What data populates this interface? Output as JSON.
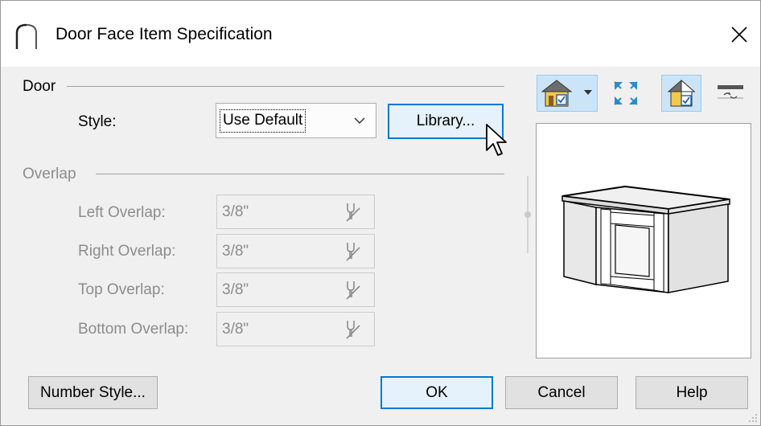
{
  "window": {
    "title": "Door Face Item Specification",
    "close_symbol": "✕"
  },
  "door_group": {
    "label": "Door",
    "style_label": "Style:",
    "style_value": "Use Default",
    "library_button": "Library..."
  },
  "overlap_group": {
    "label": "Overlap",
    "fields": [
      {
        "label": "Left Overlap:",
        "value": "3/8\""
      },
      {
        "label": "Right Overlap:",
        "value": "3/8\""
      },
      {
        "label": "Top Overlap:",
        "value": "3/8\""
      },
      {
        "label": "Bottom Overlap:",
        "value": "3/8\""
      }
    ]
  },
  "toolbar": {
    "icons": [
      "camera-view-dropdown-icon",
      "fill-window-icon",
      "show-color-icon",
      "reverse-icon"
    ]
  },
  "buttons": {
    "number_style": "Number Style...",
    "ok": "OK",
    "cancel": "Cancel",
    "help": "Help"
  },
  "colors": {
    "accent": "#0078d7",
    "active_toolbar": "#cce4f7",
    "roof_gray": "#6d6d6d",
    "house_yellow": "#f2c94c",
    "house_blue": "#4a90d9"
  }
}
